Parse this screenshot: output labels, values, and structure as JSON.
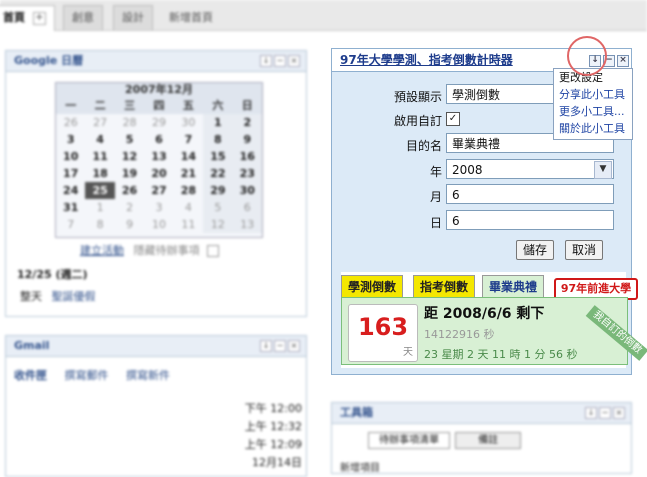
{
  "tabs": [
    {
      "label": "首頁",
      "active": true
    },
    {
      "label": "創意"
    },
    {
      "label": "設計"
    },
    {
      "label": "新增首頁"
    }
  ],
  "calendar_gadget": {
    "title": "Google 日曆",
    "month_label": "2007年12月",
    "weekdays": [
      "一",
      "二",
      "三",
      "四",
      "五",
      "六",
      "日"
    ],
    "weeks": [
      [
        "26",
        "27",
        "28",
        "29",
        "30",
        "1",
        "2"
      ],
      [
        "3",
        "4",
        "5",
        "6",
        "7",
        "8",
        "9"
      ],
      [
        "10",
        "11",
        "12",
        "13",
        "14",
        "15",
        "16"
      ],
      [
        "17",
        "18",
        "19",
        "20",
        "21",
        "22",
        "23"
      ],
      [
        "24",
        "25",
        "26",
        "27",
        "28",
        "29",
        "30"
      ],
      [
        "31",
        "1",
        "2",
        "3",
        "4",
        "5",
        "6"
      ],
      [
        "7",
        "8",
        "9",
        "10",
        "11",
        "12",
        "13"
      ]
    ],
    "actions": [
      "建立活動",
      "隱藏待辦事項"
    ],
    "event_date": "12/25 (週二)",
    "event_time": "整天",
    "event_name": "聖誕優假"
  },
  "gmail_gadget": {
    "title": "Gmail",
    "links": [
      "收件匣",
      "撰寫郵件",
      "撰寫新件"
    ],
    "times": [
      "下午 12:00",
      "上午 12:32",
      "上午 12:09",
      "12月14日"
    ]
  },
  "toolbox_gadget": {
    "title": "工具箱",
    "tabs": [
      "待辦事項清單",
      "備註"
    ],
    "new_item_label": "新增項目"
  },
  "countdown_gadget": {
    "title": "97年大學學測、指考倒數計時器",
    "settings": {
      "preset_label": "預設顯示",
      "preset_value": "學測倒數",
      "custom_label": "啟用自訂",
      "custom_checked": "✓",
      "target_label": "目的名",
      "target_value": "畢業典禮",
      "year_label": "年",
      "year_value": "2008",
      "month_label": "月",
      "month_value": "6",
      "day_label": "日",
      "day_value": "6",
      "save_label": "儲存",
      "cancel_label": "取消"
    },
    "menu": [
      "更改設定",
      "分享此小工具",
      "更多小工具...",
      "關於此小工具"
    ],
    "widget": {
      "tabs": [
        "學測倒數",
        "指考倒數",
        "畢業典禮"
      ],
      "badge": "97年前進大學",
      "ribbon": "我自訂的倒數",
      "days": "163",
      "days_unit": "天",
      "headline": "距 2008/6/6 剩下",
      "seconds": "14122916 秒",
      "detail": "23 星期 2 天 11 時 1 分 56 秒"
    }
  },
  "colors": {
    "accent": "#1e3c8c",
    "panel_bg": "#dceaf7",
    "days_red": "#d81e1e",
    "tab_yellow": "#f4e700",
    "tab_green": "#d8f0d4"
  }
}
